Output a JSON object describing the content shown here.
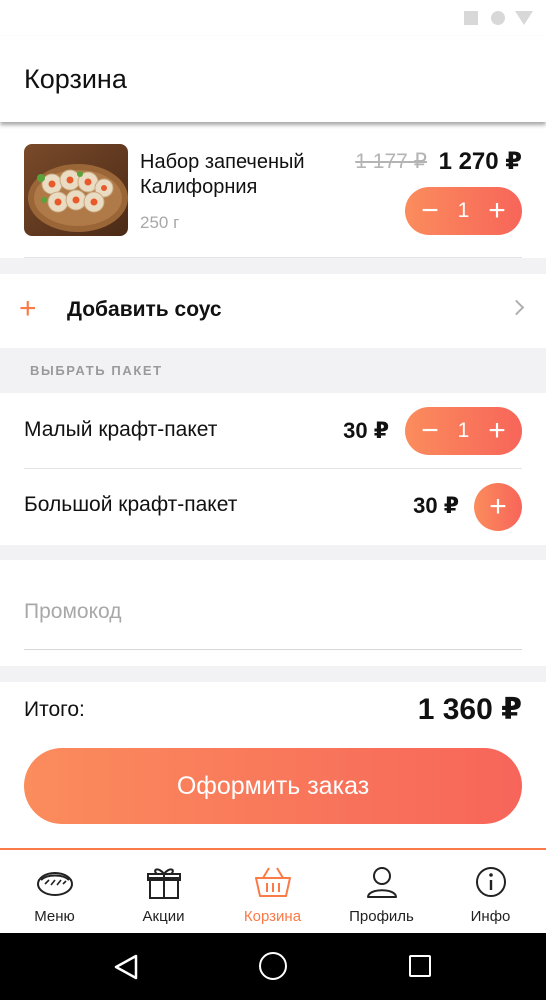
{
  "screen": {
    "title": "Корзина"
  },
  "cart_item": {
    "name": "Набор запеченый Калифорния",
    "weight": "250 г",
    "old_price": "1 177 ₽",
    "price": "1 270 ₽",
    "quantity": "1"
  },
  "sauce": {
    "label": "Добавить соус"
  },
  "bags": {
    "header": "ВЫБРАТЬ ПАКЕТ",
    "items": [
      {
        "name": "Малый крафт-пакет",
        "price": "30 ₽",
        "quantity": "1"
      },
      {
        "name": "Большой крафт-пакет",
        "price": "30 ₽"
      }
    ]
  },
  "promo": {
    "placeholder": "Промокод"
  },
  "summary": {
    "total_label": "Итого:",
    "total_value": "1 360 ₽",
    "checkout_label": "Оформить заказ"
  },
  "tabs": [
    {
      "label": "Меню",
      "icon": "sushi-icon"
    },
    {
      "label": "Акции",
      "icon": "gift-icon"
    },
    {
      "label": "Корзина",
      "icon": "basket-icon",
      "active": true
    },
    {
      "label": "Профиль",
      "icon": "profile-icon"
    },
    {
      "label": "Инфо",
      "icon": "info-icon"
    }
  ],
  "colors": {
    "accent": "#fa7a48",
    "gradient_start": "#fb8c5c",
    "gradient_end": "#f7655a"
  }
}
